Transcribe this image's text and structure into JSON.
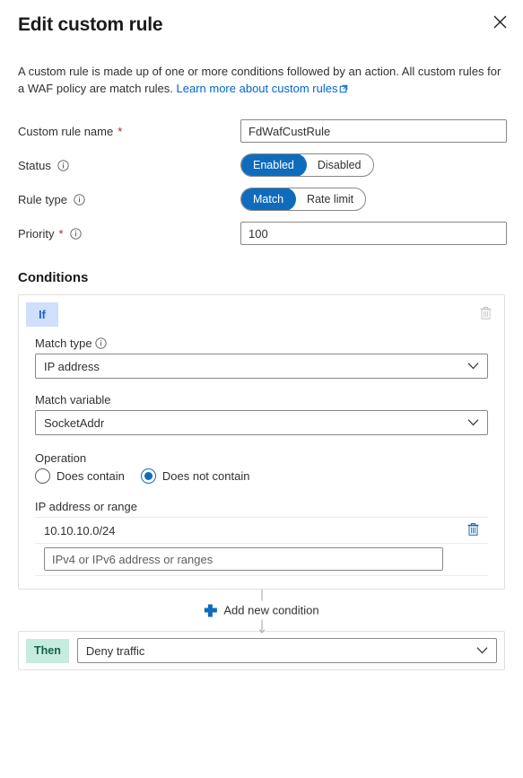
{
  "header": {
    "title": "Edit custom rule",
    "close_icon": "close-icon"
  },
  "description": {
    "text_before": "A custom rule is made up of one or more conditions followed by an action. All custom rules for a WAF policy are match rules. ",
    "link_text": "Learn more about custom rules",
    "link_icon": "external-link-icon"
  },
  "form": {
    "rule_name": {
      "label": "Custom rule name",
      "required": "*",
      "value": "FdWafCustRule",
      "placeholder": ""
    },
    "status": {
      "label": "Status",
      "info_icon": "info-icon",
      "options": [
        "Enabled",
        "Disabled"
      ],
      "selected": "Enabled"
    },
    "rule_type": {
      "label": "Rule type",
      "info_icon": "info-icon",
      "options": [
        "Match",
        "Rate limit"
      ],
      "selected": "Match"
    },
    "priority": {
      "label": "Priority",
      "required": "*",
      "info_icon": "info-icon",
      "value": "100",
      "placeholder": ""
    }
  },
  "conditions": {
    "section_title": "Conditions",
    "if_badge": "If",
    "delete_condition_icon": "trash-icon",
    "match_type": {
      "label": "Match type",
      "info_icon": "info-icon",
      "value": "IP address"
    },
    "match_variable": {
      "label": "Match variable",
      "value": "SocketAddr"
    },
    "operation": {
      "label": "Operation",
      "options": [
        "Does contain",
        "Does not contain"
      ],
      "selected": "Does not contain"
    },
    "ip_address": {
      "label": "IP address or range",
      "entries": [
        "10.10.10.0/24"
      ],
      "delete_icon": "trash-icon",
      "input_value": "",
      "input_placeholder": "IPv4 or IPv6 address or ranges"
    }
  },
  "add_condition": {
    "label": "Add new condition",
    "icon": "plus-icon"
  },
  "action": {
    "then_badge": "Then",
    "value": "Deny traffic",
    "chevron_icon": "chevron-down-icon"
  },
  "colors": {
    "accent": "#0f6cbd",
    "link": "#0066cc",
    "required": "#a4262c",
    "if_badge_bg": "#cfdffc",
    "if_badge_fg": "#1f5fc4",
    "then_badge_bg": "#c6ecdf",
    "then_badge_fg": "#11614a",
    "border": "#8a8886",
    "card_border": "#e1dfdd"
  }
}
